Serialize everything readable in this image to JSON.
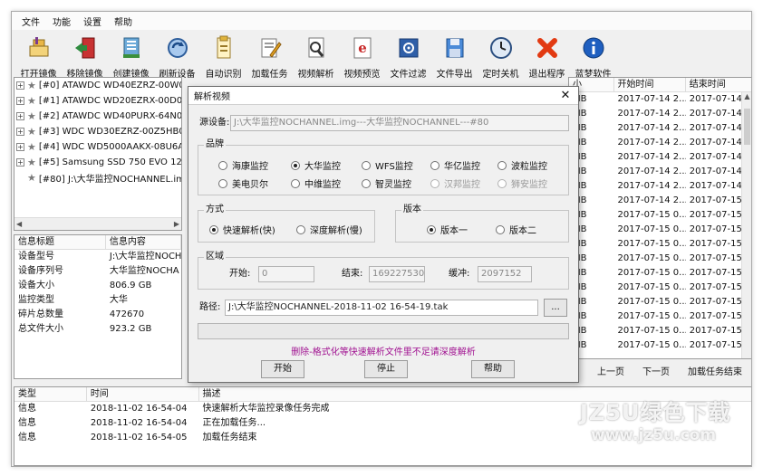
{
  "menu": [
    "文件",
    "功能",
    "设置",
    "帮助"
  ],
  "toolbar": [
    {
      "label": "打开镜像",
      "icon": "open-image-icon"
    },
    {
      "label": "移除镜像",
      "icon": "remove-image-icon"
    },
    {
      "label": "创建镜像",
      "icon": "create-image-icon"
    },
    {
      "label": "刷新设备",
      "icon": "refresh-device-icon"
    },
    {
      "label": "自动识别",
      "icon": "auto-detect-icon"
    },
    {
      "label": "加载任务",
      "icon": "load-task-icon"
    },
    {
      "label": "视频解析",
      "icon": "video-parse-icon"
    },
    {
      "label": "视频预览",
      "icon": "video-preview-icon"
    },
    {
      "label": "文件过滤",
      "icon": "file-filter-icon"
    },
    {
      "label": "文件导出",
      "icon": "file-export-icon"
    },
    {
      "label": "定时关机",
      "icon": "timer-shutdown-icon"
    },
    {
      "label": "退出程序",
      "icon": "exit-icon"
    },
    {
      "label": "蓝梦软件",
      "icon": "about-icon"
    }
  ],
  "tree": [
    {
      "text": "[#0] ATAWDC WD40EZRZ-00W0A"
    },
    {
      "text": "[#1] ATAWDC WD20EZRX-00D0A"
    },
    {
      "text": "[#2] ATAWDC WD40PURX-64N0A"
    },
    {
      "text": "[#3] WDC WD30EZRZ-00Z5HB0"
    },
    {
      "text": "[#4] WDC WD5000AAKX-08U6AA"
    },
    {
      "text": "[#5] Samsung SSD 750 EVO 120G"
    },
    {
      "text": "[#80] J:\\大华监控NOCHANNEL.img"
    }
  ],
  "info": {
    "headers": [
      "信息标题",
      "信息内容"
    ],
    "rows": [
      [
        "设备型号",
        "J:\\大华监控NOCH"
      ],
      [
        "设备序列号",
        "大华监控NOCHA"
      ],
      [
        "设备大小",
        "806.9 GB"
      ],
      [
        "监控类型",
        "大华"
      ],
      [
        "碎片总数量",
        "472670"
      ],
      [
        "总文件大小",
        "923.2 GB"
      ]
    ]
  },
  "files": {
    "headers": [
      "小",
      "开始时间",
      "结束时间"
    ],
    "rows": [
      [
        "MB",
        "2017-07-14 2...",
        "2017-07-14 2..."
      ],
      [
        "MB",
        "2017-07-14 2...",
        "2017-07-14 2..."
      ],
      [
        "MB",
        "2017-07-14 2...",
        "2017-07-14 2..."
      ],
      [
        "MB",
        "2017-07-14 2...",
        "2017-07-14 2..."
      ],
      [
        "MB",
        "2017-07-14 2...",
        "2017-07-14 2..."
      ],
      [
        "MB",
        "2017-07-14 2...",
        "2017-07-14 2..."
      ],
      [
        "MB",
        "2017-07-14 2...",
        "2017-07-14 2..."
      ],
      [
        "MB",
        "2017-07-14 2...",
        "2017-07-15 0..."
      ],
      [
        "MB",
        "2017-07-15 0...",
        "2017-07-15 0..."
      ],
      [
        "MB",
        "2017-07-15 0...",
        "2017-07-15 0..."
      ],
      [
        "MB",
        "2017-07-15 0...",
        "2017-07-15 0..."
      ],
      [
        "MB",
        "2017-07-15 0...",
        "2017-07-15 0..."
      ],
      [
        "MB",
        "2017-07-15 0...",
        "2017-07-15 0..."
      ],
      [
        "MB",
        "2017-07-15 0...",
        "2017-07-15 0..."
      ],
      [
        "MB",
        "2017-07-15 0...",
        "2017-07-15 0..."
      ],
      [
        "MB",
        "2017-07-15 0...",
        "2017-07-15 0..."
      ],
      [
        "MB",
        "2017-07-15 0...",
        "2017-07-15 0..."
      ],
      [
        "MB",
        "2017-07-15 0...",
        "2017-07-15 0..."
      ]
    ]
  },
  "pager": {
    "prev": "上一页",
    "next": "下一页",
    "end": "加载任务结束"
  },
  "log": {
    "headers": [
      "类型",
      "时间",
      "描述"
    ],
    "rows": [
      [
        "信息",
        "2018-11-02 16-54-04",
        "快速解析大华监控录像任务完成"
      ],
      [
        "信息",
        "2018-11-02 16-54-04",
        "正在加载任务..."
      ],
      [
        "信息",
        "2018-11-02 16-54-05",
        "加载任务结束"
      ]
    ]
  },
  "dialog": {
    "title": "解析视频",
    "close": "✕",
    "source_label": "源设备:",
    "source_value": "J:\\大华监控NOCHANNEL.img---大华监控NOCHANNEL---#80",
    "brand_title": "品牌",
    "brands": [
      {
        "label": "海康监控",
        "checked": false,
        "enabled": true
      },
      {
        "label": "大华监控",
        "checked": true,
        "enabled": true
      },
      {
        "label": "WFS监控",
        "checked": false,
        "enabled": true
      },
      {
        "label": "华亿监控",
        "checked": false,
        "enabled": true
      },
      {
        "label": "波粒监控",
        "checked": false,
        "enabled": true
      },
      {
        "label": "美电贝尔",
        "checked": false,
        "enabled": true
      },
      {
        "label": "中维监控",
        "checked": false,
        "enabled": true
      },
      {
        "label": "智灵监控",
        "checked": false,
        "enabled": true
      },
      {
        "label": "汉邦监控",
        "checked": false,
        "enabled": false
      },
      {
        "label": "狮安监控",
        "checked": false,
        "enabled": false
      }
    ],
    "mode_title": "方式",
    "modes": [
      {
        "label": "快速解析(快)",
        "checked": true
      },
      {
        "label": "深度解析(慢)",
        "checked": false
      }
    ],
    "version_title": "版本",
    "versions": [
      {
        "label": "版本一",
        "checked": true
      },
      {
        "label": "版本二",
        "checked": false
      }
    ],
    "region_title": "区域",
    "start_label": "开始:",
    "start_value": "0",
    "end_label": "结束:",
    "end_value": "1692275300",
    "buffer_label": "缓冲:",
    "buffer_value": "2097152",
    "path_label": "路径:",
    "path_value": "J:\\大华监控NOCHANNEL-2018-11-02 16-54-19.tak",
    "browse_label": "...",
    "warning": "删除-格式化等快速解析文件里不足请深度解析",
    "start_button": "开始",
    "stop_button": "停止",
    "help_button": "帮助"
  },
  "watermark": {
    "line1": "JZ5U绿色下载",
    "line2": "www.jz5u.com"
  }
}
